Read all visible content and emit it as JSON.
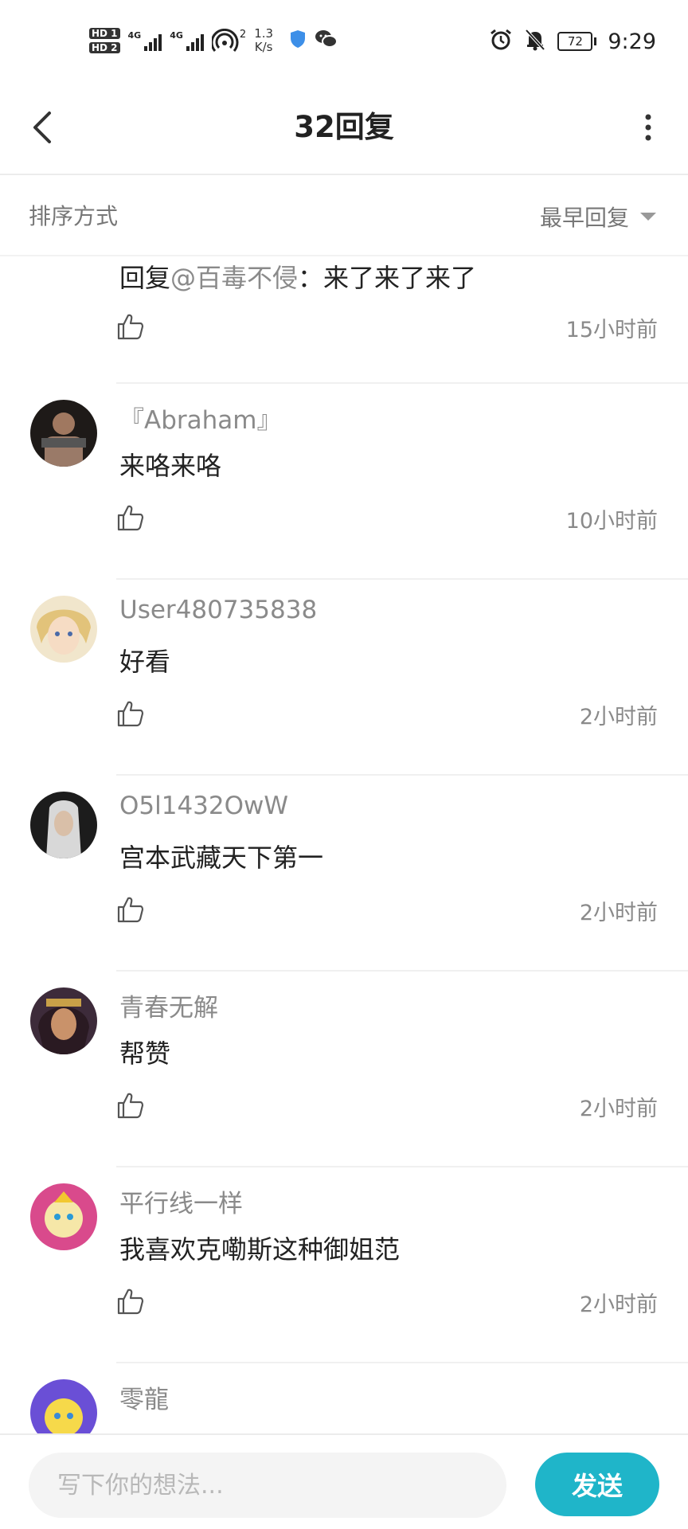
{
  "status_bar": {
    "hd1": "HD 1",
    "hd2": "HD 2",
    "net1": "4G",
    "net2": "4G",
    "hotspot_count": "2",
    "speed_value": "1.3",
    "speed_unit": "K/s",
    "battery": "72",
    "time": "9:29"
  },
  "header": {
    "title": "32回复"
  },
  "sort": {
    "label": "排序方式",
    "value": "最早回复"
  },
  "replies": [
    {
      "username": "",
      "content_prefix": "回复",
      "mention": "@百毒不侵",
      "content_suffix": "：来了来了来了",
      "time": "15小时前",
      "avatar_color": "#5a4632"
    },
    {
      "username": "『Abraham』",
      "content": "来咯来咯",
      "time": "10小时前",
      "avatar_color": "#3b2f2a"
    },
    {
      "username": "User480735838",
      "content": "好看",
      "time": "2小时前",
      "avatar_color": "#e9d7a8"
    },
    {
      "username": "O5l1432OwW",
      "content": "宫本武藏天下第一",
      "time": "2小时前",
      "avatar_color": "#2a2a2a"
    },
    {
      "username": "青春无解",
      "content": "帮赞",
      "time": "2小时前",
      "avatar_color": "#3d2b3a"
    },
    {
      "username": "平行线一样",
      "content": "我喜欢克嘞斯这种御姐范",
      "time": "2小时前",
      "avatar_color": "#d94a8c"
    },
    {
      "username": "零龍",
      "content": "",
      "time": "",
      "avatar_color": "#6a4fd6"
    }
  ],
  "composer": {
    "placeholder": "写下你的想法...",
    "send_label": "发送"
  },
  "colors": {
    "accent": "#1fb5c9",
    "muted_text": "#8a8a8a"
  }
}
